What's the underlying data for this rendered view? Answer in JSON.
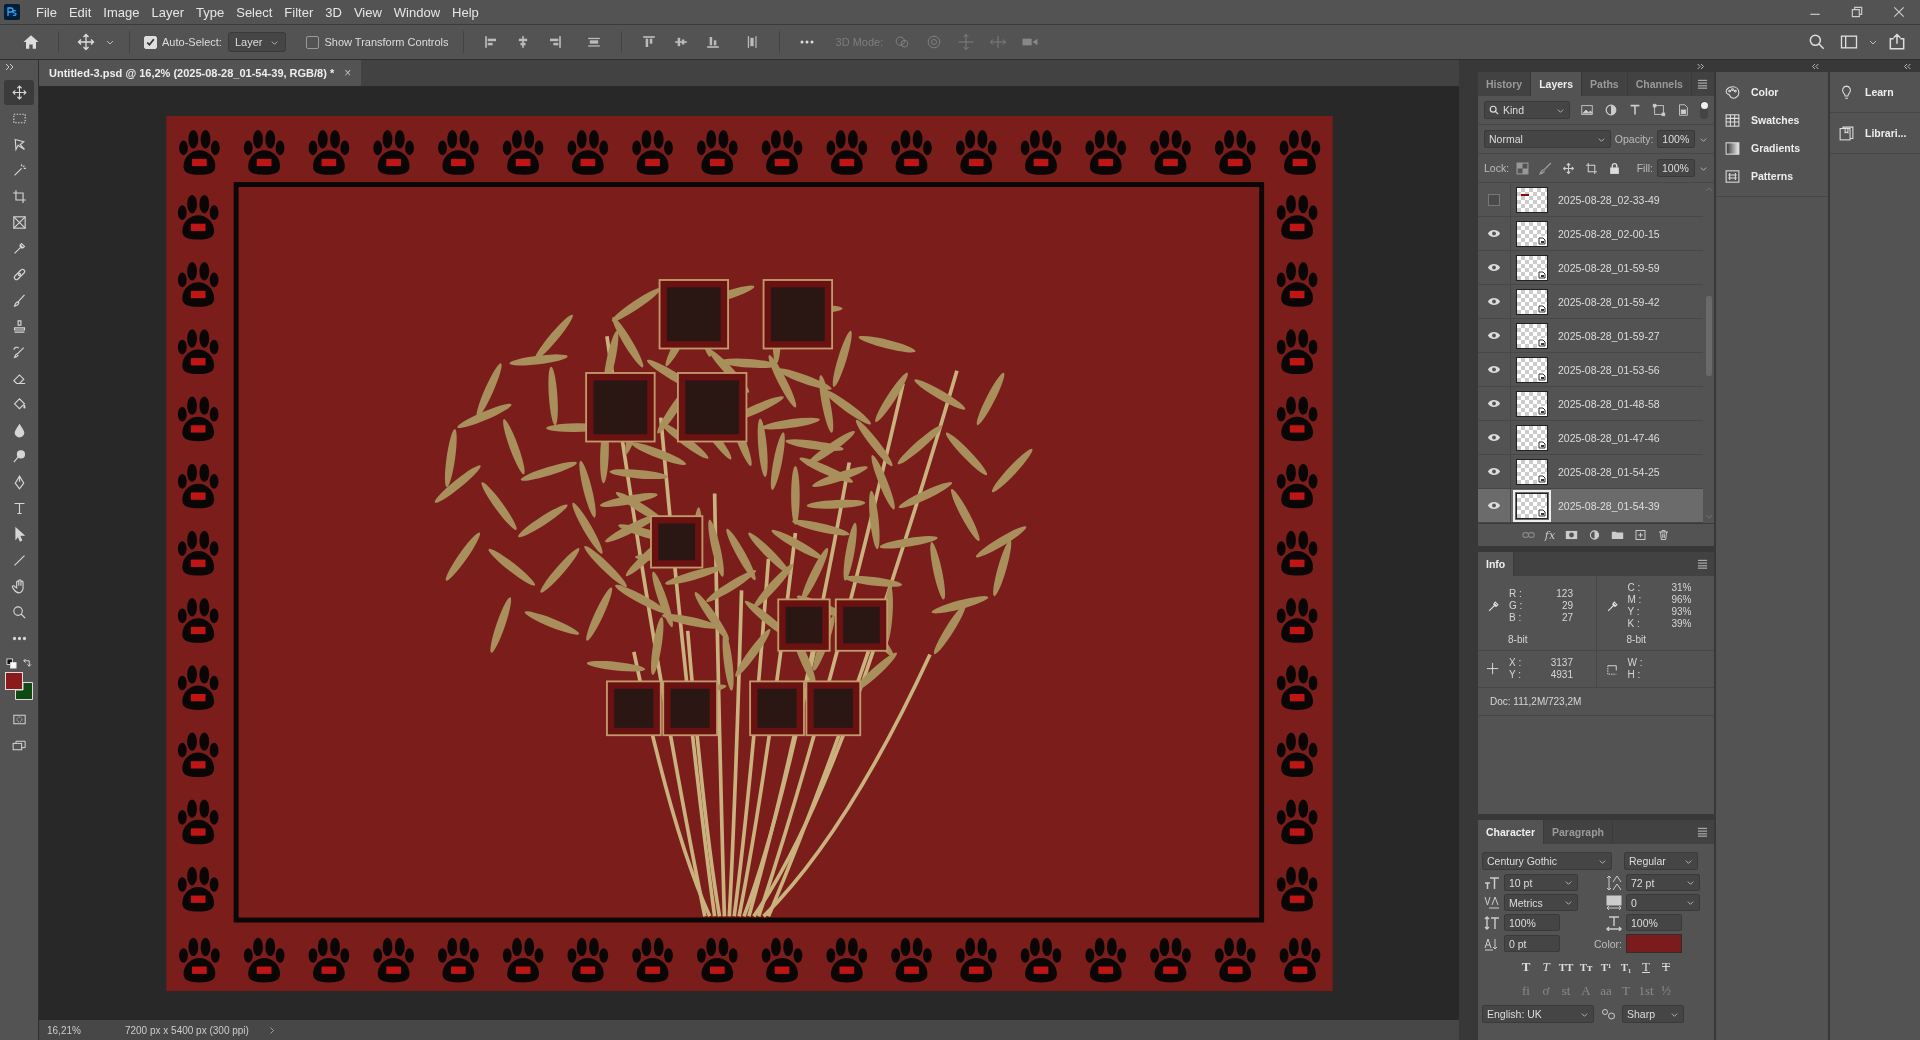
{
  "menu": [
    "File",
    "Edit",
    "Image",
    "Layer",
    "Type",
    "Select",
    "Filter",
    "3D",
    "View",
    "Window",
    "Help"
  ],
  "options_bar": {
    "auto_select": {
      "label": "Auto-Select:",
      "checked": true
    },
    "auto_select_target": "Layer",
    "show_transform_controls": {
      "label": "Show Transform Controls",
      "checked": false
    },
    "mode_3d_label": "3D Mode:"
  },
  "document_tab": {
    "title": "Untitled-3.psd @ 16,2% (2025-08-28_01-54-39, RGB/8) *",
    "close": "×"
  },
  "tools": [
    {
      "kind": "move",
      "selected": true
    },
    {
      "kind": "marquee",
      "selected": false
    },
    {
      "kind": "lasso",
      "selected": false
    },
    {
      "kind": "wand",
      "selected": false
    },
    {
      "kind": "crop",
      "selected": false
    },
    {
      "kind": "frame",
      "selected": false
    },
    {
      "kind": "eyedropper",
      "selected": false
    },
    {
      "kind": "healing",
      "selected": false
    },
    {
      "kind": "brush",
      "selected": false
    },
    {
      "kind": "stamp",
      "selected": false
    },
    {
      "kind": "historybrush",
      "selected": false
    },
    {
      "kind": "eraser",
      "selected": false
    },
    {
      "kind": "bucket",
      "selected": false
    },
    {
      "kind": "blur",
      "selected": false
    },
    {
      "kind": "dodge",
      "selected": false
    },
    {
      "kind": "pen",
      "selected": false
    },
    {
      "kind": "type",
      "selected": false
    },
    {
      "kind": "pathselect",
      "selected": false
    },
    {
      "kind": "line",
      "selected": false
    },
    {
      "kind": "hand",
      "selected": false
    },
    {
      "kind": "zoom",
      "selected": false
    },
    {
      "kind": "more",
      "selected": false
    }
  ],
  "swatch_colors": {
    "foreground": {
      "color": "#8b1a1a"
    },
    "background": {
      "color": "#0e4a12"
    }
  },
  "layers_panel": {
    "tabs": [
      {
        "label": "History",
        "selected": false
      },
      {
        "label": "Layers",
        "selected": true
      },
      {
        "label": "Paths",
        "selected": false
      },
      {
        "label": "Channels",
        "selected": false
      }
    ],
    "filter": "Kind",
    "blend_mode": "Normal",
    "opacity_label": "Opacity:",
    "opacity": "100%",
    "lock_label": "Lock:",
    "fill_label": "Fill:",
    "fill": "100%",
    "fx_label": "fx",
    "layers": [
      {
        "name": "2025-08-28_02-33-49",
        "visible": false,
        "selected": false,
        "kind": "raster"
      },
      {
        "name": "2025-08-28_02-00-15",
        "visible": true,
        "selected": false,
        "kind": "smart"
      },
      {
        "name": "2025-08-28_01-59-59",
        "visible": true,
        "selected": false,
        "kind": "smart"
      },
      {
        "name": "2025-08-28_01-59-42",
        "visible": true,
        "selected": false,
        "kind": "smart"
      },
      {
        "name": "2025-08-28_01-59-27",
        "visible": true,
        "selected": false,
        "kind": "smart"
      },
      {
        "name": "2025-08-28_01-53-56",
        "visible": true,
        "selected": false,
        "kind": "smart"
      },
      {
        "name": "2025-08-28_01-48-58",
        "visible": true,
        "selected": false,
        "kind": "smart"
      },
      {
        "name": "2025-08-28_01-47-46",
        "visible": true,
        "selected": false,
        "kind": "smart"
      },
      {
        "name": "2025-08-28_01-54-25",
        "visible": true,
        "selected": false,
        "kind": "smart"
      },
      {
        "name": "2025-08-28_01-54-39",
        "visible": true,
        "selected": true,
        "kind": "smart"
      }
    ]
  },
  "side_panels": [
    {
      "label": "Color",
      "kind": "color"
    },
    {
      "label": "Swatches",
      "kind": "swatches"
    },
    {
      "label": "Gradients",
      "kind": "gradients"
    },
    {
      "label": "Patterns",
      "kind": "patterns"
    }
  ],
  "learn_panels": [
    {
      "label": "Learn",
      "kind": "learn"
    },
    {
      "label": "Librari...",
      "kind": "libraries"
    }
  ],
  "info_panel": {
    "title": "Info",
    "rgb": [
      {
        "label": "R :",
        "value": "123"
      },
      {
        "label": "G :",
        "value": "29"
      },
      {
        "label": "B :",
        "value": "27"
      }
    ],
    "rgb_depth": "8-bit",
    "cmyk": [
      {
        "label": "C :",
        "value": "31%"
      },
      {
        "label": "M :",
        "value": "96%"
      },
      {
        "label": "Y :",
        "value": "93%"
      },
      {
        "label": "K :",
        "value": "39%"
      }
    ],
    "cmyk_depth": "8-bit",
    "position": [
      {
        "label": "X :",
        "value": "3137"
      },
      {
        "label": "Y :",
        "value": "4931"
      }
    ],
    "size": [
      {
        "label": "W :"
      },
      {
        "label": "H :"
      }
    ],
    "doc": "Doc: 111,2M/723,2M"
  },
  "character_panel": {
    "tabs": [
      {
        "label": "Character",
        "selected": true
      },
      {
        "label": "Paragraph",
        "selected": false
      }
    ],
    "font_family": "Century Gothic",
    "font_style": "Regular",
    "size": "10 pt",
    "leading": "72 pt",
    "kerning": "Metrics",
    "tracking": "0",
    "vertical_scale": "100%",
    "horizontal_scale": "100%",
    "baseline_shift": "0 pt",
    "color_label": "Color:",
    "color": "#7b1b1b",
    "style_buttons": [
      {
        "glyph": "T",
        "kind": "bold"
      },
      {
        "glyph": "T",
        "kind": "italic"
      },
      {
        "glyph": "TT",
        "kind": "caps"
      },
      {
        "glyph": "Tт",
        "kind": "plain"
      },
      {
        "glyph": "T¹",
        "kind": "plain"
      },
      {
        "glyph": "T₁",
        "kind": "plain"
      },
      {
        "glyph": "T",
        "kind": "underline"
      },
      {
        "glyph": "T",
        "kind": "strike"
      }
    ],
    "opentype_buttons": [
      {
        "glyph": "fi",
        "disabled": true
      },
      {
        "glyph": "ơ",
        "disabled": true
      },
      {
        "glyph": "st",
        "disabled": true
      },
      {
        "glyph": "A",
        "disabled": true
      },
      {
        "glyph": "aa",
        "disabled": true
      },
      {
        "glyph": "T",
        "disabled": true
      },
      {
        "glyph": "1st",
        "disabled": true
      },
      {
        "glyph": "½",
        "disabled": true
      }
    ],
    "language": "English: UK",
    "antialias": "Sharp"
  },
  "status_bar": {
    "zoom": "16,21%",
    "doc_size": "7200 px x 5400 px (300 ppi)"
  }
}
